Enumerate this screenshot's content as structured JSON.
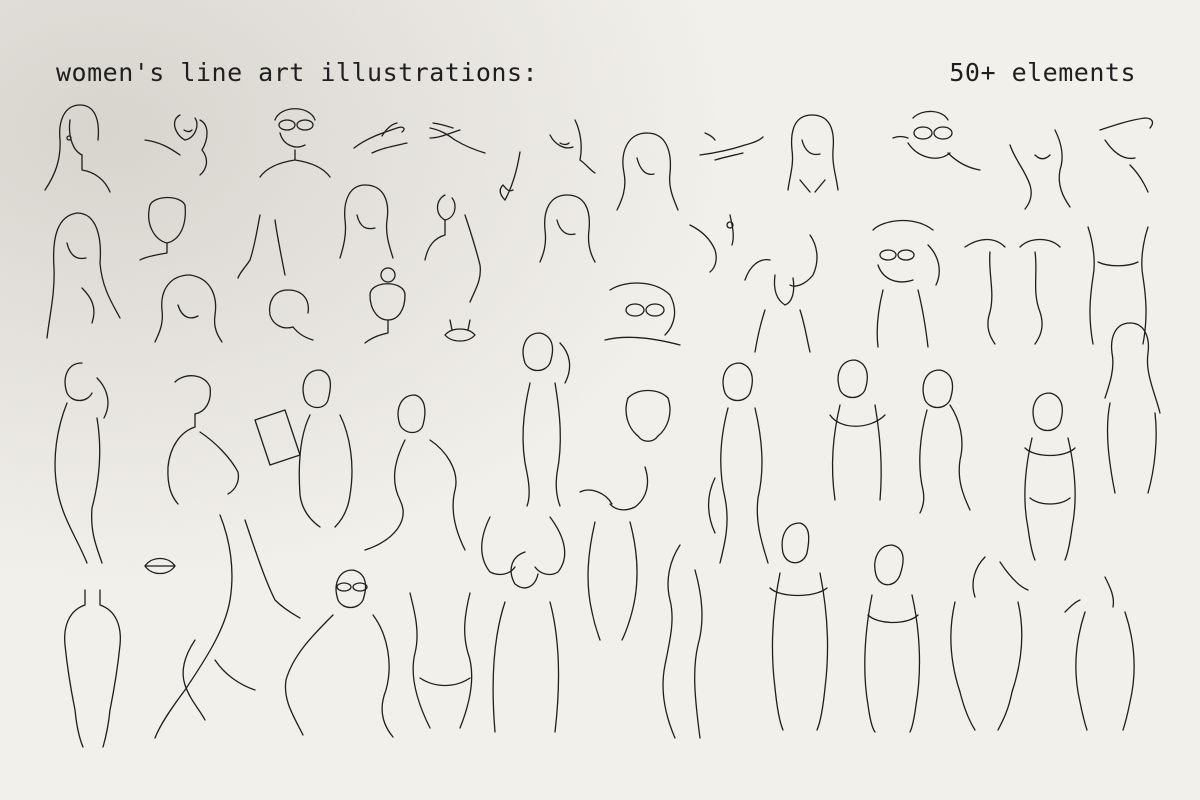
{
  "header": {
    "title": "women's line art illustrations:",
    "count": "50+ elements"
  },
  "colors": {
    "background": "#f4f2ed",
    "ink": "#1e1e1e"
  }
}
